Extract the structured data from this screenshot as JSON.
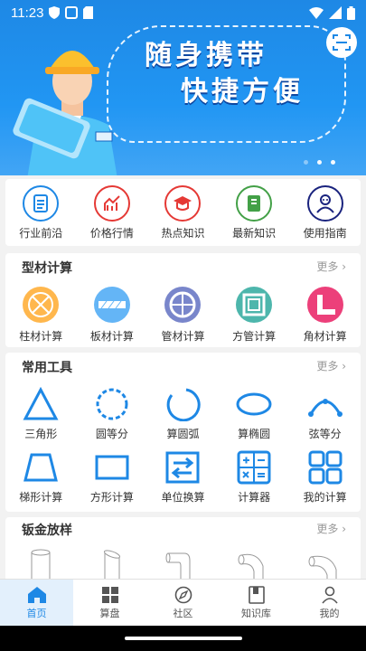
{
  "status": {
    "time": "11:23"
  },
  "banner": {
    "line1": "随身携带",
    "line2": "快捷方便"
  },
  "quick": [
    {
      "label": "行业前沿",
      "color": "#1e88e5"
    },
    {
      "label": "价格行情",
      "color": "#e53935"
    },
    {
      "label": "热点知识",
      "color": "#e53935"
    },
    {
      "label": "最新知识",
      "color": "#43a047"
    },
    {
      "label": "使用指南",
      "color": "#1a237e"
    }
  ],
  "profile": {
    "title": "型材计算",
    "more": "更多",
    "items": [
      "柱材计算",
      "板材计算",
      "管材计算",
      "方管计算",
      "角材计算"
    ]
  },
  "tools": {
    "title": "常用工具",
    "more": "更多",
    "row1": [
      "三角形",
      "圆等分",
      "算圆弧",
      "算椭圆",
      "弦等分"
    ],
    "row2": [
      "梯形计算",
      "方形计算",
      "单位换算",
      "计算器",
      "我的计算"
    ]
  },
  "sheet": {
    "title": "钣金放样",
    "more": "更多"
  },
  "tabs": [
    "首页",
    "算盘",
    "社区",
    "知识库",
    "我的"
  ],
  "colors": {
    "accent": "#1e88e5",
    "tool": "#1e88e5"
  }
}
